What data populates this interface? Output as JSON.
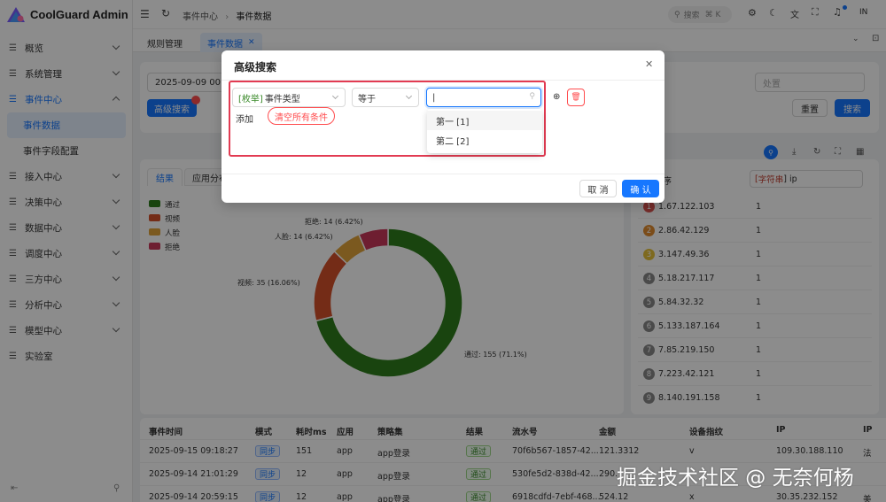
{
  "app": {
    "title": "CoolGuard Admin"
  },
  "sidebar": {
    "items": [
      {
        "label": "概览"
      },
      {
        "label": "系统管理"
      },
      {
        "label": "事件中心"
      },
      {
        "label": "事件数据"
      },
      {
        "label": "事件字段配置"
      },
      {
        "label": "接入中心"
      },
      {
        "label": "决策中心"
      },
      {
        "label": "数据中心"
      },
      {
        "label": "调度中心"
      },
      {
        "label": "三方中心"
      },
      {
        "label": "分析中心"
      },
      {
        "label": "模型中心"
      },
      {
        "label": "实验室"
      }
    ]
  },
  "header": {
    "breadcrumb": [
      "事件中心",
      "事件数据"
    ],
    "search_label": "搜索",
    "search_shortcut": "⌘ K",
    "avatar_initials": "IN"
  },
  "tabs": [
    {
      "label": "规则管理"
    },
    {
      "label": "事件数据"
    }
  ],
  "filter": {
    "date_value": "2025-09-09 00:0",
    "advanced_search_label": "高级搜索",
    "result_placeholder": "处置",
    "reset_label": "重置",
    "search_label": "搜索"
  },
  "result_tabs": [
    "结果",
    "应用分布"
  ],
  "pie": {
    "legend": [
      {
        "label": "通过",
        "color": "#2e7d1c"
      },
      {
        "label": "视频",
        "color": "#d4502a"
      },
      {
        "label": "人脸",
        "color": "#e0a23a"
      },
      {
        "label": "拒绝",
        "color": "#c8375a"
      }
    ],
    "labels": [
      {
        "text": "拒绝: 14 (6.42%)"
      },
      {
        "text": "人脸: 14 (6.42%)"
      },
      {
        "text": "视频: 35 (16.06%)"
      },
      {
        "text": "通过: 155 (71.1%)"
      }
    ]
  },
  "chart_data": {
    "type": "pie",
    "categories": [
      "通过",
      "视频",
      "人脸",
      "拒绝"
    ],
    "values": [
      155,
      35,
      14,
      14
    ],
    "percentages": [
      71.1,
      16.06,
      6.42,
      6.42
    ],
    "colors": [
      "#2e7d1c",
      "#d4502a",
      "#e0a23a",
      "#c8375a"
    ],
    "legend_position": "top-left"
  },
  "ranking": {
    "header_col1": "字符串",
    "header_col1_prefix": "[",
    "header_col1_suffix": "] ip",
    "partial_header": "序",
    "rows": [
      {
        "rank": "1",
        "ip": "1.67.122.103",
        "count": "1",
        "color": "#d9534f"
      },
      {
        "rank": "2",
        "ip": "2.86.42.129",
        "count": "1",
        "color": "#e08a2e"
      },
      {
        "rank": "3",
        "ip": "3.147.49.36",
        "count": "1",
        "color": "#e6c13a"
      },
      {
        "rank": "4",
        "ip": "5.18.217.117",
        "count": "1",
        "color": "#888888"
      },
      {
        "rank": "5",
        "ip": "5.84.32.32",
        "count": "1",
        "color": "#888888"
      },
      {
        "rank": "6",
        "ip": "5.133.187.164",
        "count": "1",
        "color": "#888888"
      },
      {
        "rank": "7",
        "ip": "7.85.219.150",
        "count": "1",
        "color": "#888888"
      },
      {
        "rank": "8",
        "ip": "7.223.42.121",
        "count": "1",
        "color": "#888888"
      },
      {
        "rank": "9",
        "ip": "8.140.191.158",
        "count": "1",
        "color": "#888888"
      }
    ]
  },
  "table": {
    "headers": [
      "事件时间",
      "模式",
      "耗时ms",
      "应用",
      "策略集",
      "结果",
      "流水号",
      "金额",
      "设备指纹",
      "IP",
      "IP"
    ],
    "rows": [
      {
        "time": "2025-09-15 09:18:27",
        "mode": "同步",
        "ms": "151",
        "app": "app",
        "policy": "app登录",
        "result": "通过",
        "serial": "70f6b567-1857-42...",
        "amount": "121.3312",
        "device": "v",
        "ip": "109.30.188.110",
        "ip2": "法"
      },
      {
        "time": "2025-09-14 21:01:29",
        "mode": "同步",
        "ms": "12",
        "app": "app",
        "policy": "app登录",
        "result": "通过",
        "serial": "530fe5d2-838d-42...",
        "amount": "290.",
        "device": "",
        "ip": "",
        "ip2": ""
      },
      {
        "time": "2025-09-14 20:59:15",
        "mode": "同步",
        "ms": "12",
        "app": "app",
        "policy": "app登录",
        "result": "通过",
        "serial": "6918cdfd-7ebf-468...",
        "amount": "524.12",
        "device": "x",
        "ip": "30.35.232.152",
        "ip2": "美"
      }
    ]
  },
  "modal": {
    "title": "高级搜索",
    "field_prefix": "[枚举]",
    "field_value": "事件类型",
    "operator_value": "等于",
    "value_input": "|",
    "add_label": "添加",
    "clear_label": "清空所有条件",
    "options": [
      "第一 [1]",
      "第二 [2]"
    ],
    "cancel_label": "取 消",
    "confirm_label": "确 认"
  },
  "watermark": "掘金技术社区 @ 无奈何杨"
}
